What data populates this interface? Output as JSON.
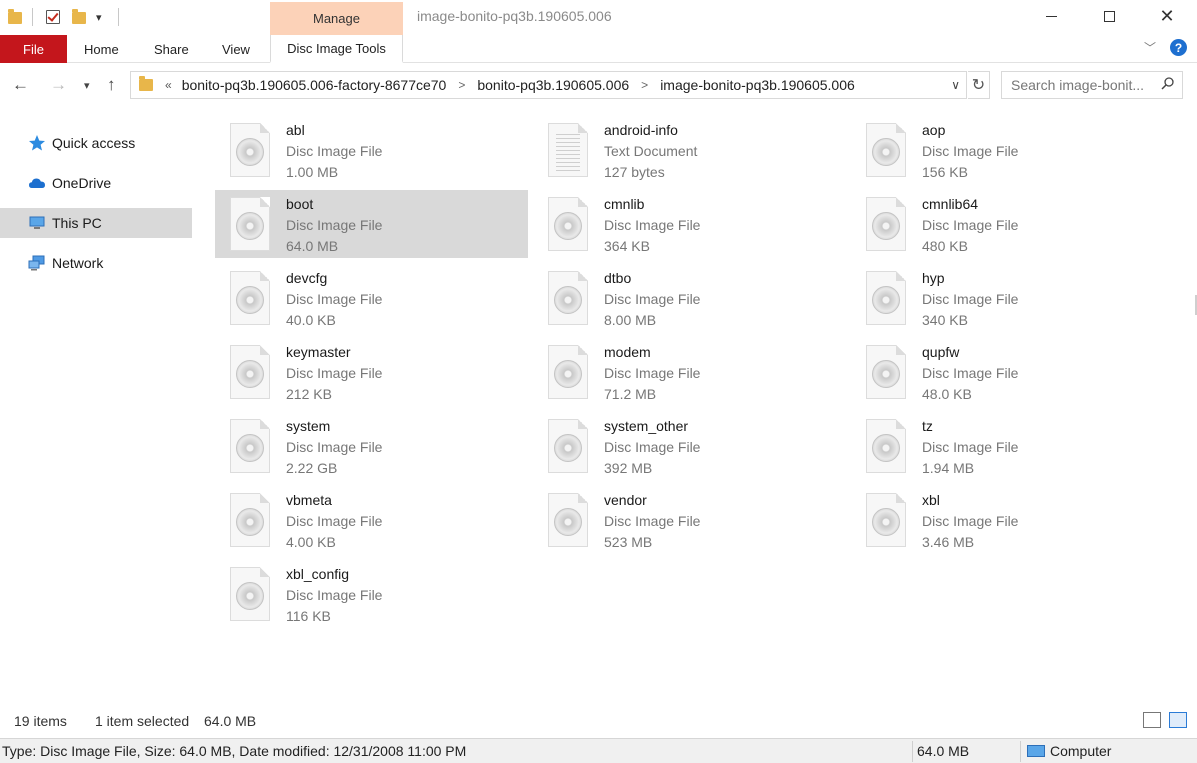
{
  "window": {
    "title": "image-bonito-pq3b.190605.006",
    "context_tab": "Manage",
    "min_label": "—",
    "max_label": "□",
    "close_label": "✕"
  },
  "ribbon": {
    "tabs": [
      {
        "label": "File"
      },
      {
        "label": "Home"
      },
      {
        "label": "Share"
      },
      {
        "label": "View"
      },
      {
        "label": "Disc Image Tools"
      }
    ],
    "accent": "#c4161c",
    "context_color": "#fcd2b8"
  },
  "address": {
    "overflow": "«",
    "crumbs": [
      "bonito-pq3b.190605.006-factory-8677ce70",
      "bonito-pq3b.190605.006",
      "image-bonito-pq3b.190605.006"
    ],
    "search_placeholder": "Search image-bonit..."
  },
  "sidebar": {
    "items": [
      {
        "label": "Quick access",
        "icon": "star-icon"
      },
      {
        "label": "OneDrive",
        "icon": "cloud-icon"
      },
      {
        "label": "This PC",
        "icon": "computer-icon"
      },
      {
        "label": "Network",
        "icon": "network-icon"
      }
    ],
    "selected": "This PC"
  },
  "files": [
    {
      "name": "abl",
      "type": "Disc Image File",
      "size": "1.00 MB"
    },
    {
      "name": "android-info",
      "type": "Text Document",
      "size": "127 bytes"
    },
    {
      "name": "aop",
      "type": "Disc Image File",
      "size": "156 KB"
    },
    {
      "name": "boot",
      "type": "Disc Image File",
      "size": "64.0 MB"
    },
    {
      "name": "cmnlib",
      "type": "Disc Image File",
      "size": "364 KB"
    },
    {
      "name": "cmnlib64",
      "type": "Disc Image File",
      "size": "480 KB"
    },
    {
      "name": "devcfg",
      "type": "Disc Image File",
      "size": "40.0 KB"
    },
    {
      "name": "dtbo",
      "type": "Disc Image File",
      "size": "8.00 MB"
    },
    {
      "name": "hyp",
      "type": "Disc Image File",
      "size": "340 KB"
    },
    {
      "name": "keymaster",
      "type": "Disc Image File",
      "size": "212 KB"
    },
    {
      "name": "modem",
      "type": "Disc Image File",
      "size": "71.2 MB"
    },
    {
      "name": "qupfw",
      "type": "Disc Image File",
      "size": "48.0 KB"
    },
    {
      "name": "system",
      "type": "Disc Image File",
      "size": "2.22 GB"
    },
    {
      "name": "system_other",
      "type": "Disc Image File",
      "size": "392 MB"
    },
    {
      "name": "tz",
      "type": "Disc Image File",
      "size": "1.94 MB"
    },
    {
      "name": "vbmeta",
      "type": "Disc Image File",
      "size": "4.00 KB"
    },
    {
      "name": "vendor",
      "type": "Disc Image File",
      "size": "523 MB"
    },
    {
      "name": "xbl",
      "type": "Disc Image File",
      "size": "3.46 MB"
    },
    {
      "name": "xbl_config",
      "type": "Disc Image File",
      "size": "116 KB"
    }
  ],
  "selected_file": "boot",
  "status": {
    "item_count": "19 items",
    "selection": "1 item selected",
    "selection_size": "64.0 MB"
  },
  "details_bar": {
    "info": "Type: Disc Image File, Size: 64.0 MB, Date modified: 12/31/2008 11:00 PM",
    "size": "64.0 MB",
    "location": "Computer"
  }
}
